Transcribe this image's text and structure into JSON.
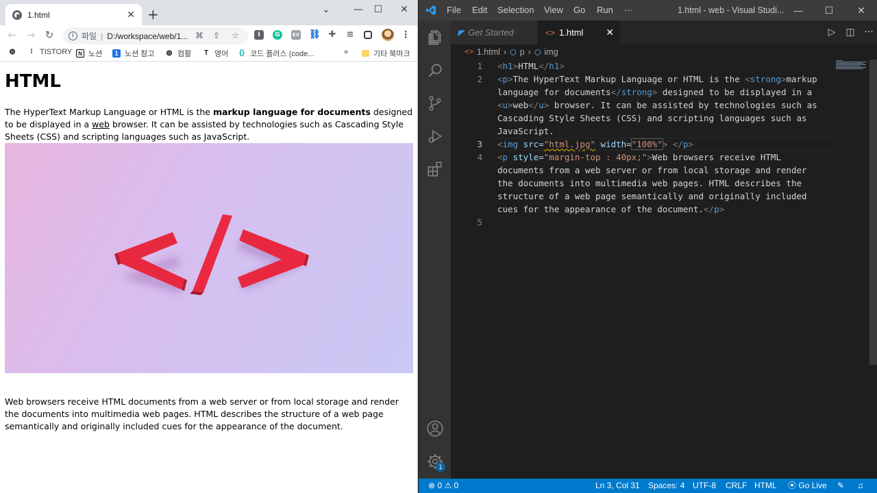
{
  "browser": {
    "tab_title": "1.html",
    "tab_close": "✕",
    "new_tab": "+",
    "controls": {
      "dropdown": "⌄",
      "minimize": "—",
      "maximize": "☐",
      "close": "✕"
    },
    "address": {
      "scheme": "파일",
      "separator": "|",
      "url": "D:/workspace/web/1..."
    },
    "bookmarks": [
      {
        "label": "",
        "icon": "globe-icon"
      },
      {
        "label": "TISTORY",
        "icon": "tistory-icon"
      },
      {
        "label": "노션",
        "icon": "notion-icon"
      },
      {
        "label": "노션 참고",
        "icon": "notion-ref-icon"
      },
      {
        "label": "컴활",
        "icon": "globe-icon"
      },
      {
        "label": "영어",
        "icon": "font-icon"
      },
      {
        "label": "코드 플러스 (code...",
        "icon": "braces-icon"
      },
      {
        "label": "»",
        "icon": ""
      },
      {
        "label": "기타 북마크",
        "icon": "folder-icon"
      }
    ],
    "page": {
      "heading": "HTML",
      "intro_a": "The HyperText Markup Language or HTML is the ",
      "intro_strong": "markup language for documents",
      "intro_b": " designed to be displayed in a ",
      "intro_u": "web",
      "intro_c": " browser. It can be assisted by technologies such as Cascading Style Sheets (CSS) and scripting languages such as JavaScript.",
      "outro": "Web browsers receive HTML documents from a web server or from local storage and render the documents into multimedia web pages. HTML describes the structure of a web page semantically and originally included cues for the appearance of the document."
    }
  },
  "vscode": {
    "menu": [
      "File",
      "Edit",
      "Selection",
      "View",
      "Go",
      "Run",
      "···"
    ],
    "window_title": "1.html - web - Visual Studi...",
    "tabs": [
      {
        "label": "Get Started",
        "active": false
      },
      {
        "label": "1.html",
        "active": true
      }
    ],
    "tab_close": "✕",
    "breadcrumbs": [
      "1.html",
      "p",
      "img"
    ],
    "line_numbers": [
      "1",
      "2",
      "",
      "",
      "",
      "",
      "3",
      "4",
      "",
      "",
      "",
      "",
      "5"
    ],
    "code": {
      "l1": {
        "o1": "<",
        "n1": "h1",
        "c1": ">",
        "txt": "HTML",
        "o2": "</",
        "n2": "h1",
        "c2": ">"
      },
      "l2a": {
        "o1": "<",
        "n1": "p",
        "c1": ">",
        "txt": "The HyperText Markup Language or HTML is the ",
        "o2": "<",
        "n2": "strong",
        "c2": ">",
        "txt2": "markup"
      },
      "l2b": {
        "txt": "language for documents",
        "o": "</",
        "n": "strong",
        "c": ">",
        "txt2": " designed to be displayed in a"
      },
      "l2c": {
        "o1": "<",
        "n1": "u",
        "c1": ">",
        "txt": "web",
        "o2": "</",
        "n2": "u",
        "c2": ">",
        "txt2": " browser. It can be assisted by technologies such as"
      },
      "l2d": {
        "txt": "Cascading Style Sheets (CSS) and scripting languages such as"
      },
      "l2e": {
        "txt": "JavaScript."
      },
      "l3": {
        "o1": "<",
        "n1": "img",
        "a1": " src",
        "eq1": "=",
        "s1": "\"html.jpg\"",
        "a2": " width",
        "eq2": "=",
        "s2": "\"100%\"",
        "c1": ">",
        "sp": " ",
        "o2": "</",
        "n2": "p",
        "c2": ">"
      },
      "l4a": {
        "o1": "<",
        "n1": "p",
        "a1": " style",
        "eq1": "=",
        "s1": "\"margin-top : 40px;\"",
        "c1": ">",
        "txt": "Web browsers receive HTML"
      },
      "l4b": {
        "txt": "documents from a web server or from local storage and render"
      },
      "l4c": {
        "txt": "the documents into multimedia web pages. HTML describes the"
      },
      "l4d": {
        "txt": "structure of a web page semantically and originally included"
      },
      "l4e": {
        "txt": "cues for the appearance of the document.",
        "o": "</",
        "n": "p",
        "c": ">"
      }
    },
    "status": {
      "errors": "0",
      "warnings": "0",
      "position": "Ln 3, Col 31",
      "spaces": "Spaces: 4",
      "encoding": "UTF-8",
      "eol": "CRLF",
      "language": "HTML",
      "golive": "Go Live"
    },
    "settings_badge": "1"
  }
}
